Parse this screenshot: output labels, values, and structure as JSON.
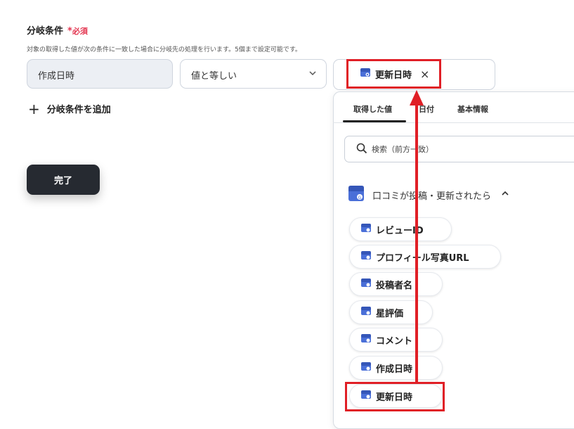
{
  "header": {
    "title": "分岐条件",
    "required_star": "*",
    "required_label": "必須",
    "description": "対象の取得した値が次の条件に一致した場合に分岐先の処理を行います。5個まで設定可能です。"
  },
  "condition": {
    "field_value": "作成日時",
    "operator_value": "値と等しい",
    "target_tag": "更新日時",
    "tag_remove": "×"
  },
  "add_condition_label": "分岐条件を追加",
  "add_condition_plus": "+",
  "done_label": "完了",
  "panel": {
    "tabs": [
      "取得した値",
      "日付",
      "基本情報"
    ],
    "active_tab": 0,
    "search_placeholder": "検索（前方一致）",
    "group_label": "口コミが投稿・更新されたら",
    "items": [
      "レビューID",
      "プロフィール写真URL",
      "投稿者名",
      "星評価",
      "コメント",
      "作成日時",
      "更新日時"
    ]
  },
  "icons": {
    "app_icon": "google-business-profile-icon",
    "search_icon": "search-icon",
    "chevron": "chevron-down-icon",
    "collapse": "chevron-up-icon"
  },
  "colors": {
    "accent_red": "#e01f26",
    "required_red": "#e3344f",
    "done_bg": "#262a31",
    "icon_blue": "#4a6fd8"
  }
}
